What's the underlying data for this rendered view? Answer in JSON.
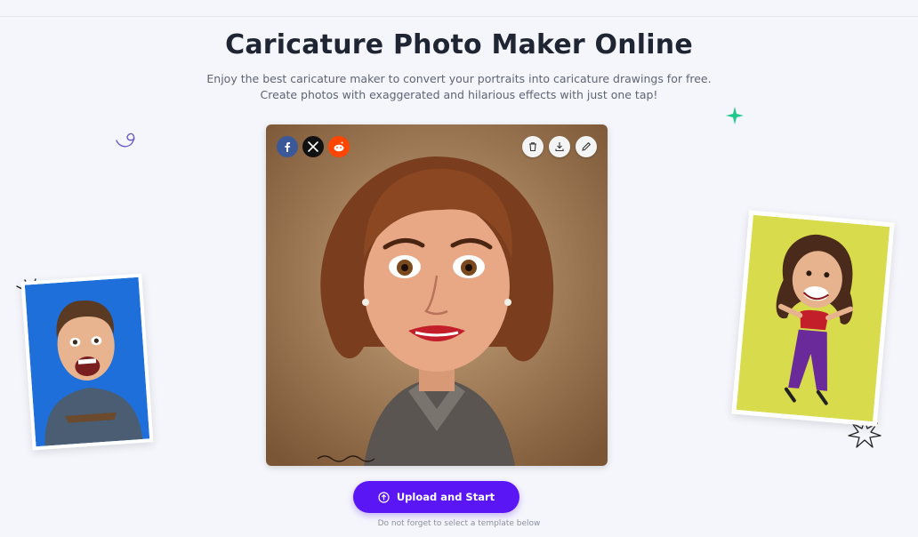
{
  "page": {
    "title": "Caricature Photo Maker Online",
    "subtitle_line1": "Enjoy the best caricature maker to convert your portraits into caricature drawings for free.",
    "subtitle_line2": "Create photos with exaggerated and hilarious effects with just one tap!"
  },
  "preview": {
    "share_icons": [
      "facebook-icon",
      "x-twitter-icon",
      "reddit-icon"
    ],
    "tool_icons": [
      "trash-icon",
      "download-icon",
      "edit-pencil-icon"
    ],
    "signature_text": "signature"
  },
  "actions": {
    "upload_label": "Upload and Start",
    "hint": "Do not forget to select a template below"
  },
  "colors": {
    "accent": "#5a16f5",
    "facebook": "#3b5998",
    "reddit": "#ff4500",
    "left_card_bg": "#1e6fd9",
    "right_card_bg": "#d8dc4c",
    "sparkle": "#1fc98a"
  }
}
